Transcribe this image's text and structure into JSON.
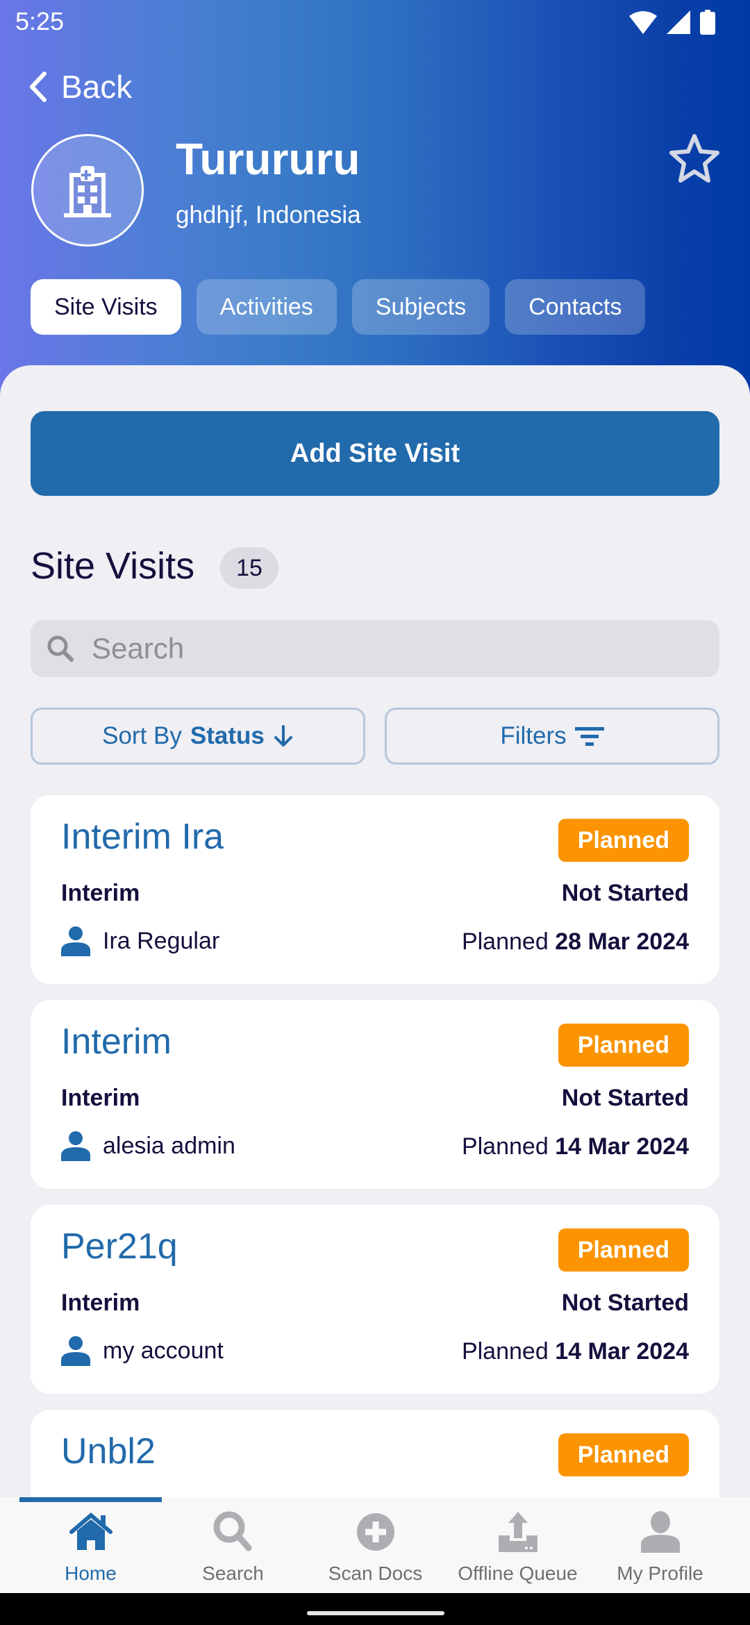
{
  "status_bar": {
    "time": "5:25"
  },
  "header": {
    "back_label": "Back",
    "site_name": "Turururu",
    "site_location": "ghdhjf, Indonesia",
    "favorite": false
  },
  "tabs": [
    {
      "label": "Site Visits",
      "active": true
    },
    {
      "label": "Activities",
      "active": false
    },
    {
      "label": "Subjects",
      "active": false
    },
    {
      "label": "Contacts",
      "active": false
    }
  ],
  "actions": {
    "add_label": "Add Site Visit"
  },
  "section": {
    "title": "Site Visits",
    "count": "15"
  },
  "search": {
    "placeholder": "Search",
    "value": ""
  },
  "sort": {
    "prefix": "Sort By",
    "field": "Status",
    "direction": "descending"
  },
  "filters": {
    "label": "Filters"
  },
  "visits": [
    {
      "title": "Interim Ira",
      "badge": "Planned",
      "type": "Interim",
      "status": "Not Started",
      "person": "Ira Regular",
      "date_prefix": "Planned",
      "date": "28 Mar 2024"
    },
    {
      "title": "Interim",
      "badge": "Planned",
      "type": "Interim",
      "status": "Not Started",
      "person": "alesia admin",
      "date_prefix": "Planned",
      "date": "14 Mar 2024"
    },
    {
      "title": "Per21q",
      "badge": "Planned",
      "type": "Interim",
      "status": "Not Started",
      "person": "my account",
      "date_prefix": "Planned",
      "date": "14 Mar 2024"
    },
    {
      "title": "Unbl2",
      "badge": "Planned"
    }
  ],
  "bottom_nav": [
    {
      "label": "Home",
      "icon": "home-icon",
      "active": true
    },
    {
      "label": "Search",
      "icon": "search-icon",
      "active": false
    },
    {
      "label": "Scan Docs",
      "icon": "plus-circle-icon",
      "active": false
    },
    {
      "label": "Offline Queue",
      "icon": "upload-icon",
      "active": false
    },
    {
      "label": "My Profile",
      "icon": "person-icon",
      "active": false
    }
  ],
  "colors": {
    "primary": "#216aab",
    "badge_planned": "#fb9400",
    "text_dark": "#13103d",
    "background": "#efeff4"
  }
}
